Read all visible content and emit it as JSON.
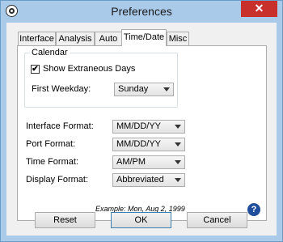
{
  "window": {
    "title": "Preferences",
    "close_glyph": "✕",
    "icon": "gear-icon"
  },
  "tabs": [
    {
      "label": "Interface"
    },
    {
      "label": "Analysis"
    },
    {
      "label": "Auto"
    },
    {
      "label": "Time/Date",
      "active": true
    },
    {
      "label": "Misc"
    }
  ],
  "calendar": {
    "legend": "Calendar",
    "show_extraneous_days": {
      "label": "Show Extraneous Days",
      "checked": true,
      "mark": "✔"
    },
    "first_weekday": {
      "label": "First Weekday:",
      "value": "Sunday"
    }
  },
  "formats": {
    "interface": {
      "label": "Interface Format:",
      "value": "MM/DD/YY"
    },
    "port": {
      "label": "Port Format:",
      "value": "MM/DD/YY"
    },
    "time": {
      "label": "Time Format:",
      "value": "AM/PM"
    },
    "display": {
      "label": "Display Format:",
      "value": "Abbreviated"
    }
  },
  "example": "Example: Mon, Aug 2, 1999",
  "help_glyph": "?",
  "buttons": {
    "reset": "Reset",
    "ok": "OK",
    "cancel": "Cancel"
  },
  "colors": {
    "title_bar": "#aacaea",
    "close_button": "#c7302b",
    "help": "#1f4f9c"
  }
}
